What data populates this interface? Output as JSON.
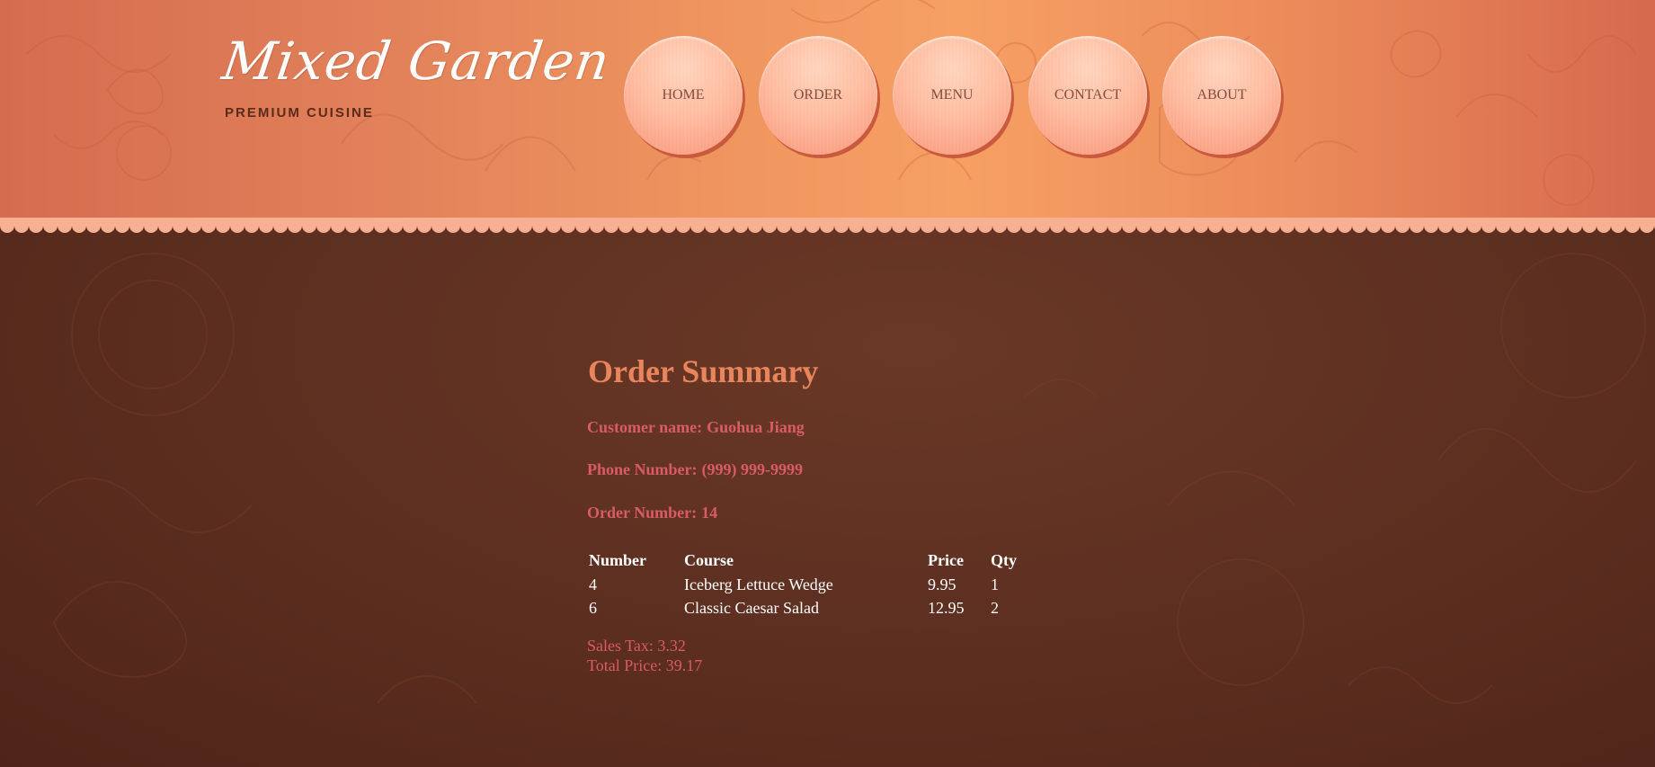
{
  "header": {
    "logo": "Mixed Garden",
    "tagline": "PREMIUM CUISINE"
  },
  "nav": {
    "items": [
      {
        "label": "HOME"
      },
      {
        "label": "ORDER"
      },
      {
        "label": "MENU"
      },
      {
        "label": "CONTACT"
      },
      {
        "label": "ABOUT"
      }
    ]
  },
  "summary": {
    "title": "Order Summary",
    "customer_label": "Customer name:",
    "customer_value": "Guohua Jiang",
    "phone_label": "Phone Number:",
    "phone_value": "(999) 999-9999",
    "order_label": "Order Number:",
    "order_value": "14",
    "table": {
      "headers": [
        "Number",
        "Course",
        "Price",
        "Qty"
      ],
      "rows": [
        [
          "4",
          "Iceberg Lettuce Wedge",
          "9.95",
          "1"
        ],
        [
          "6",
          "Classic Caesar Salad",
          "12.95",
          "2"
        ]
      ]
    },
    "tax_label": "Sales Tax:",
    "tax_value": "3.32",
    "total_label": "Total Price:",
    "total_value": "39.17"
  },
  "colors": {
    "header_accent": "#f0965f",
    "background": "#5e3021",
    "title": "#e9855c",
    "info_text": "#d85c62",
    "table_text": "#ffffff"
  }
}
